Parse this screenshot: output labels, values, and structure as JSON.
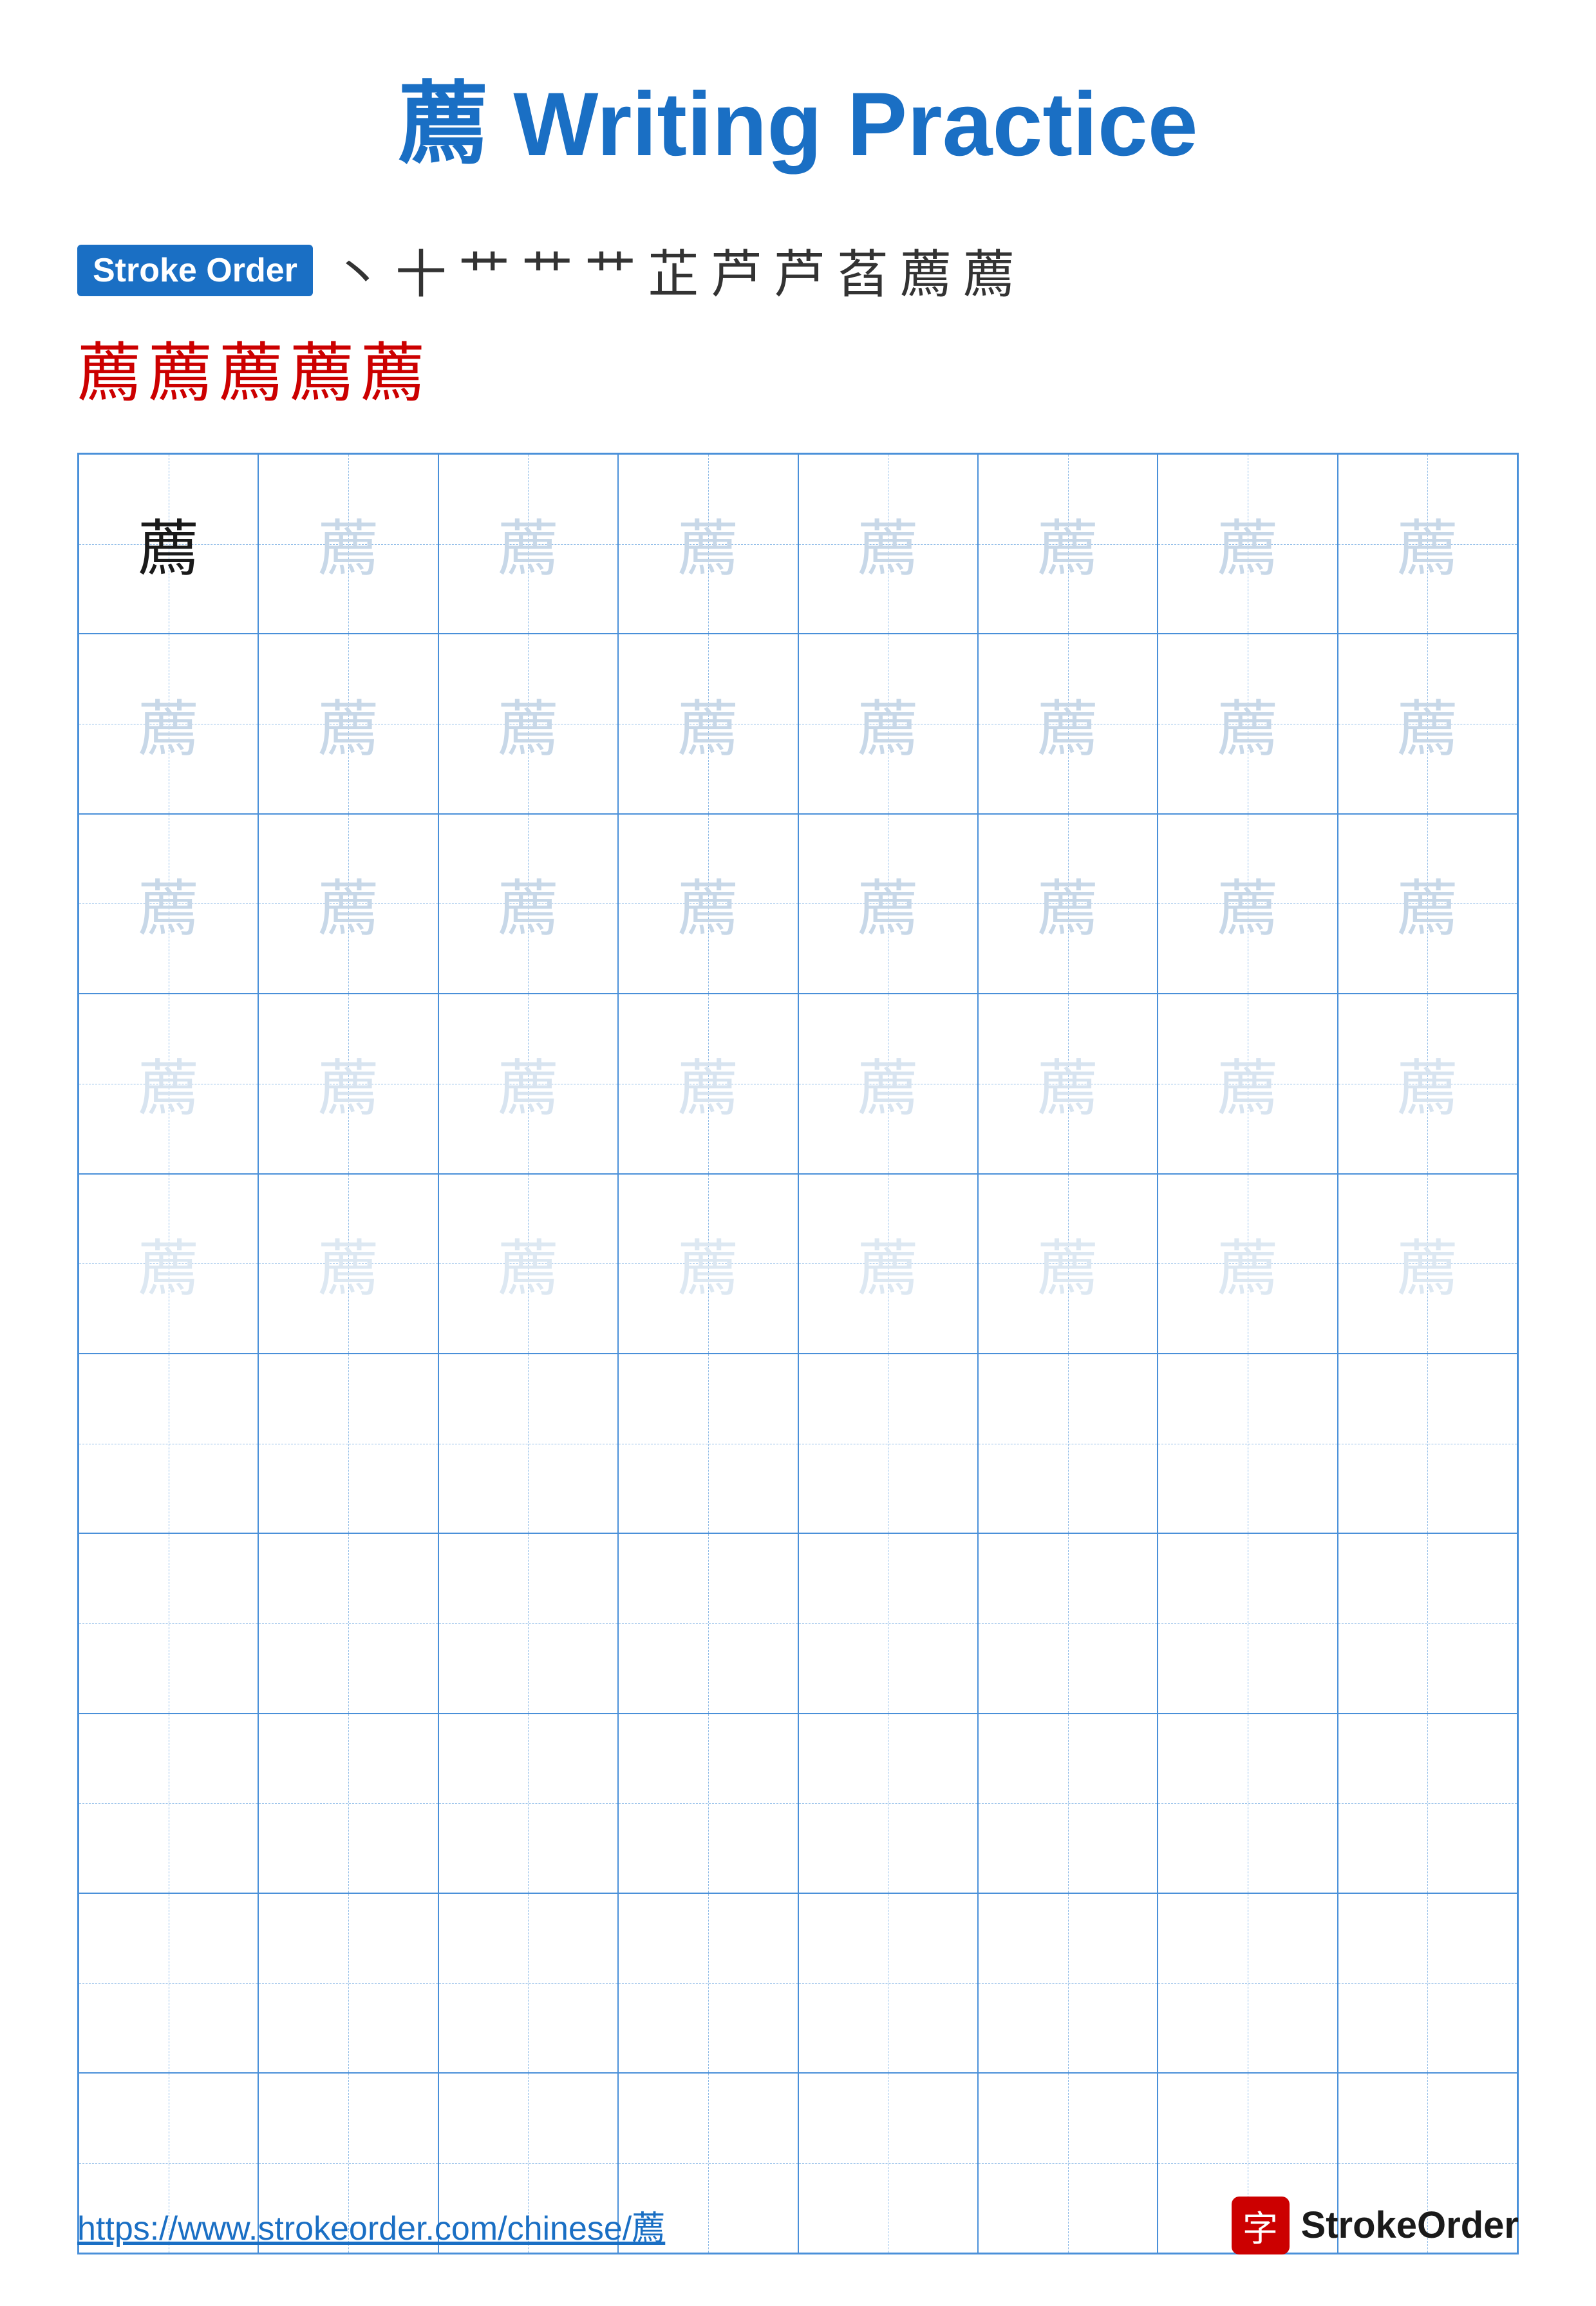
{
  "title": {
    "char": "薦",
    "rest": " Writing Practice"
  },
  "stroke_order": {
    "badge_label": "Stroke Order",
    "strokes_row1": [
      "丶",
      "十",
      "艹",
      "艹",
      "艹",
      "芷",
      "芦",
      "芦",
      "萏",
      "薦",
      "薦"
    ],
    "strokes_row2": [
      "薦",
      "薦",
      "薦",
      "薦",
      "薦"
    ]
  },
  "grid": {
    "char": "薦",
    "rows": 10,
    "cols": 8,
    "filled_rows": 5,
    "empty_rows": 5
  },
  "footer": {
    "url": "https://www.strokeorder.com/chinese/薦",
    "logo_char": "字",
    "logo_text": "StrokeOrder"
  }
}
